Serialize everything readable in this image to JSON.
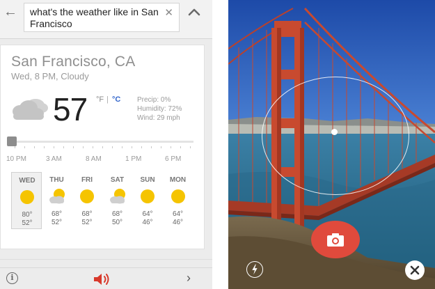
{
  "search": {
    "query": "what's the weather like in San Francisco",
    "clear_symbol": "✕"
  },
  "weather": {
    "location": "San Francisco, CA",
    "condition": "Wed, 8 PM, Cloudy",
    "temperature": "57",
    "unit_f": "°F",
    "unit_separator": "|",
    "unit_c": "°C",
    "precip": "Precip: 0%",
    "humidity": "Humidity: 72%",
    "wind": "Wind: 29 mph",
    "hourly_labels": [
      "10 PM",
      "3 AM",
      "8 AM",
      "1 PM",
      "6 PM"
    ],
    "forecast": [
      {
        "day": "WED",
        "icon": "sun-icon",
        "high": "80°",
        "low": "52°",
        "selected": true
      },
      {
        "day": "THU",
        "icon": "partly-cloudy-icon",
        "high": "68°",
        "low": "52°",
        "selected": false
      },
      {
        "day": "FRI",
        "icon": "sun-icon",
        "high": "68°",
        "low": "52°",
        "selected": false
      },
      {
        "day": "SAT",
        "icon": "partly-cloudy-icon",
        "high": "68°",
        "low": "50°",
        "selected": false
      },
      {
        "day": "SUN",
        "icon": "sun-icon",
        "high": "64°",
        "low": "46°",
        "selected": false
      },
      {
        "day": "MON",
        "icon": "sun-icon",
        "high": "64°",
        "low": "46°",
        "selected": false
      }
    ]
  },
  "bottom_bar": {
    "info_symbol": "i",
    "next_symbol": "›"
  },
  "icons": {
    "back": "back-arrow-icon",
    "collapse": "chevron-up-icon",
    "clear": "close-icon",
    "current_weather": "cloud-icon",
    "speaker": "speaker-icon",
    "camera": "camera-icon",
    "flash": "flash-icon",
    "close_camera": "close-icon"
  },
  "colors": {
    "accent_blue": "#3366cc",
    "speaker_red": "#d8392b",
    "shutter_red": "#e04a3c",
    "sun_yellow": "#f5c400"
  }
}
